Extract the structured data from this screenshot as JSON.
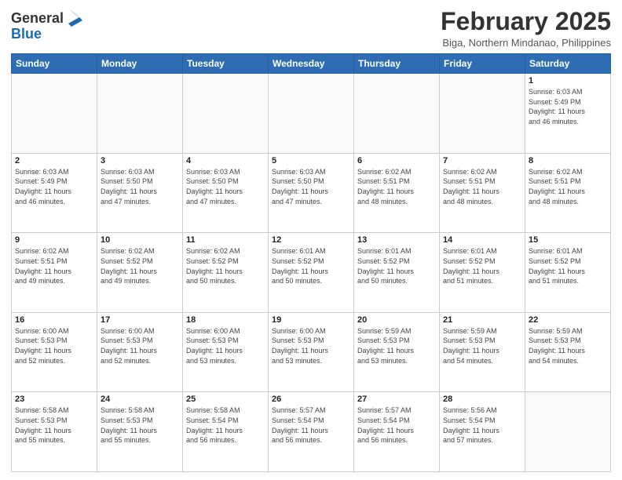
{
  "header": {
    "logo_line1": "General",
    "logo_line2": "Blue",
    "month": "February 2025",
    "location": "Biga, Northern Mindanao, Philippines"
  },
  "weekdays": [
    "Sunday",
    "Monday",
    "Tuesday",
    "Wednesday",
    "Thursday",
    "Friday",
    "Saturday"
  ],
  "weeks": [
    [
      {
        "day": "",
        "info": ""
      },
      {
        "day": "",
        "info": ""
      },
      {
        "day": "",
        "info": ""
      },
      {
        "day": "",
        "info": ""
      },
      {
        "day": "",
        "info": ""
      },
      {
        "day": "",
        "info": ""
      },
      {
        "day": "1",
        "info": "Sunrise: 6:03 AM\nSunset: 5:49 PM\nDaylight: 11 hours\nand 46 minutes."
      }
    ],
    [
      {
        "day": "2",
        "info": "Sunrise: 6:03 AM\nSunset: 5:49 PM\nDaylight: 11 hours\nand 46 minutes."
      },
      {
        "day": "3",
        "info": "Sunrise: 6:03 AM\nSunset: 5:50 PM\nDaylight: 11 hours\nand 47 minutes."
      },
      {
        "day": "4",
        "info": "Sunrise: 6:03 AM\nSunset: 5:50 PM\nDaylight: 11 hours\nand 47 minutes."
      },
      {
        "day": "5",
        "info": "Sunrise: 6:03 AM\nSunset: 5:50 PM\nDaylight: 11 hours\nand 47 minutes."
      },
      {
        "day": "6",
        "info": "Sunrise: 6:02 AM\nSunset: 5:51 PM\nDaylight: 11 hours\nand 48 minutes."
      },
      {
        "day": "7",
        "info": "Sunrise: 6:02 AM\nSunset: 5:51 PM\nDaylight: 11 hours\nand 48 minutes."
      },
      {
        "day": "8",
        "info": "Sunrise: 6:02 AM\nSunset: 5:51 PM\nDaylight: 11 hours\nand 48 minutes."
      }
    ],
    [
      {
        "day": "9",
        "info": "Sunrise: 6:02 AM\nSunset: 5:51 PM\nDaylight: 11 hours\nand 49 minutes."
      },
      {
        "day": "10",
        "info": "Sunrise: 6:02 AM\nSunset: 5:52 PM\nDaylight: 11 hours\nand 49 minutes."
      },
      {
        "day": "11",
        "info": "Sunrise: 6:02 AM\nSunset: 5:52 PM\nDaylight: 11 hours\nand 50 minutes."
      },
      {
        "day": "12",
        "info": "Sunrise: 6:01 AM\nSunset: 5:52 PM\nDaylight: 11 hours\nand 50 minutes."
      },
      {
        "day": "13",
        "info": "Sunrise: 6:01 AM\nSunset: 5:52 PM\nDaylight: 11 hours\nand 50 minutes."
      },
      {
        "day": "14",
        "info": "Sunrise: 6:01 AM\nSunset: 5:52 PM\nDaylight: 11 hours\nand 51 minutes."
      },
      {
        "day": "15",
        "info": "Sunrise: 6:01 AM\nSunset: 5:52 PM\nDaylight: 11 hours\nand 51 minutes."
      }
    ],
    [
      {
        "day": "16",
        "info": "Sunrise: 6:00 AM\nSunset: 5:53 PM\nDaylight: 11 hours\nand 52 minutes."
      },
      {
        "day": "17",
        "info": "Sunrise: 6:00 AM\nSunset: 5:53 PM\nDaylight: 11 hours\nand 52 minutes."
      },
      {
        "day": "18",
        "info": "Sunrise: 6:00 AM\nSunset: 5:53 PM\nDaylight: 11 hours\nand 53 minutes."
      },
      {
        "day": "19",
        "info": "Sunrise: 6:00 AM\nSunset: 5:53 PM\nDaylight: 11 hours\nand 53 minutes."
      },
      {
        "day": "20",
        "info": "Sunrise: 5:59 AM\nSunset: 5:53 PM\nDaylight: 11 hours\nand 53 minutes."
      },
      {
        "day": "21",
        "info": "Sunrise: 5:59 AM\nSunset: 5:53 PM\nDaylight: 11 hours\nand 54 minutes."
      },
      {
        "day": "22",
        "info": "Sunrise: 5:59 AM\nSunset: 5:53 PM\nDaylight: 11 hours\nand 54 minutes."
      }
    ],
    [
      {
        "day": "23",
        "info": "Sunrise: 5:58 AM\nSunset: 5:53 PM\nDaylight: 11 hours\nand 55 minutes."
      },
      {
        "day": "24",
        "info": "Sunrise: 5:58 AM\nSunset: 5:53 PM\nDaylight: 11 hours\nand 55 minutes."
      },
      {
        "day": "25",
        "info": "Sunrise: 5:58 AM\nSunset: 5:54 PM\nDaylight: 11 hours\nand 56 minutes."
      },
      {
        "day": "26",
        "info": "Sunrise: 5:57 AM\nSunset: 5:54 PM\nDaylight: 11 hours\nand 56 minutes."
      },
      {
        "day": "27",
        "info": "Sunrise: 5:57 AM\nSunset: 5:54 PM\nDaylight: 11 hours\nand 56 minutes."
      },
      {
        "day": "28",
        "info": "Sunrise: 5:56 AM\nSunset: 5:54 PM\nDaylight: 11 hours\nand 57 minutes."
      },
      {
        "day": "",
        "info": ""
      }
    ]
  ]
}
